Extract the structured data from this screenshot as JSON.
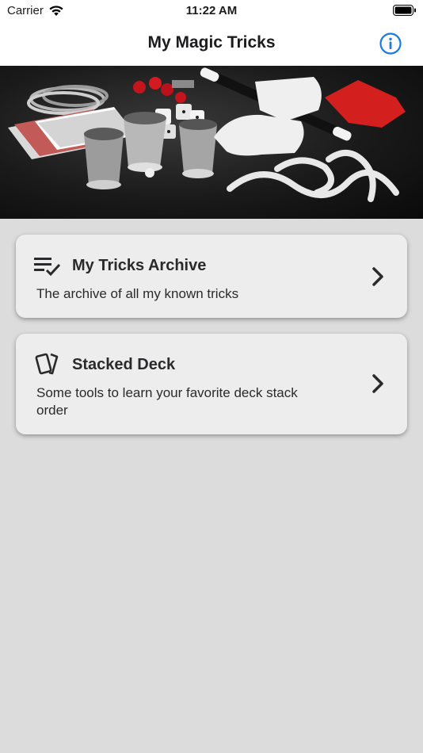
{
  "status_bar": {
    "carrier": "Carrier",
    "time": "11:22 AM"
  },
  "nav": {
    "title": "My Magic Tricks",
    "info_icon": "info-circle-icon",
    "accent_color": "#1a7ae0"
  },
  "hero": {
    "image_icon": "magic-props-photo"
  },
  "menu": {
    "items": [
      {
        "icon": "checklist-icon",
        "title": "My Tricks Archive",
        "description": "The archive of all my known tricks"
      },
      {
        "icon": "cards-icon",
        "title": "Stacked Deck",
        "description": "Some tools to learn your favorite deck stack order"
      }
    ]
  }
}
